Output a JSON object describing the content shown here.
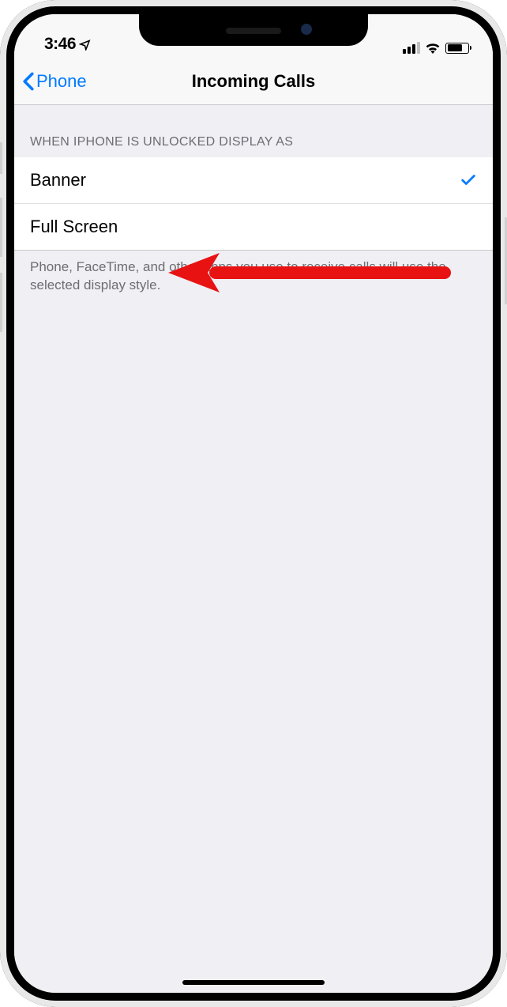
{
  "status_bar": {
    "time": "3:46"
  },
  "nav": {
    "back_label": "Phone",
    "title": "Incoming Calls"
  },
  "section": {
    "header": "WHEN IPHONE IS UNLOCKED DISPLAY AS",
    "options": {
      "banner": "Banner",
      "full_screen": "Full Screen"
    },
    "selected": "banner",
    "footer": "Phone, FaceTime, and other apps you use to receive calls will use the selected display style."
  }
}
